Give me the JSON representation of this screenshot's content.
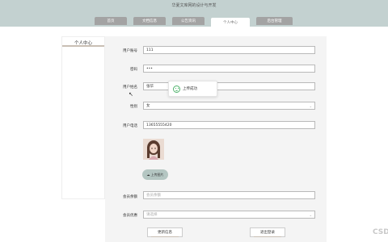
{
  "header": {
    "site_title": "华夏文库网的设计与开发"
  },
  "nav": {
    "items": [
      {
        "label": "首页"
      },
      {
        "label": "文档信息"
      },
      {
        "label": "公告资讯"
      },
      {
        "label": "个人中心"
      },
      {
        "label": "后台管理"
      }
    ],
    "active_index": 3
  },
  "sidebar": {
    "title": "个人中心"
  },
  "form": {
    "user_account": {
      "label": "用户账号",
      "value": "111"
    },
    "password": {
      "label": "密码",
      "value": "•••"
    },
    "user_name": {
      "label": "用户姓名",
      "value": "张华"
    },
    "gender": {
      "label": "性别",
      "value": "女"
    },
    "phone": {
      "label": "用户电话",
      "value": "13655555420"
    },
    "upload_button": "上传图片",
    "balance": {
      "label": "会员余额",
      "placeholder": "会员余额"
    },
    "membership": {
      "label": "会员优惠",
      "placeholder": "请选择"
    },
    "update_button": "更新信息",
    "logout_button": "退出登录"
  },
  "toast": {
    "message": "上传成功"
  },
  "watermark": "CSD",
  "colors": {
    "header_bg": "#c3d1d0",
    "nav_item_bg": "#a3a3a3",
    "accent_bar": "#c9bfb4",
    "panel_bg": "#f4f4f4",
    "upload_btn_bg": "#b4c6c2",
    "success_green": "#4fb36b"
  }
}
